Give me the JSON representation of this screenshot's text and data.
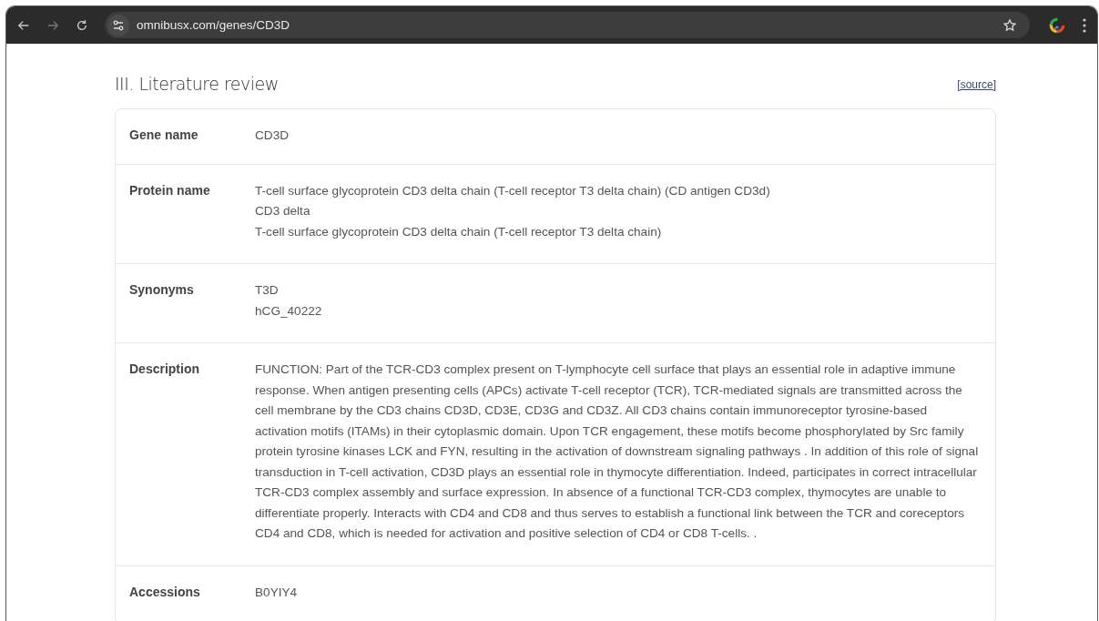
{
  "browser": {
    "url": "omnibusx.com/genes/CD3D"
  },
  "section": {
    "title": "III. Literature review",
    "source_link": "[source]"
  },
  "rows": [
    {
      "label": "Gene name",
      "values": [
        "CD3D"
      ]
    },
    {
      "label": "Protein name",
      "values": [
        "T-cell surface glycoprotein CD3 delta chain (T-cell receptor T3 delta chain) (CD antigen CD3d)",
        "CD3 delta",
        "T-cell surface glycoprotein CD3 delta chain (T-cell receptor T3 delta chain)"
      ]
    },
    {
      "label": "Synonyms",
      "values": [
        "T3D",
        "hCG_40222"
      ]
    },
    {
      "label": "Description",
      "values": [
        "FUNCTION: Part of the TCR-CD3 complex present on T-lymphocyte cell surface that plays an essential role in adaptive immune response. When antigen presenting cells (APCs) activate T-cell receptor (TCR), TCR-mediated signals are transmitted across the cell membrane by the CD3 chains CD3D, CD3E, CD3G and CD3Z. All CD3 chains contain immunoreceptor tyrosine-based activation motifs (ITAMs) in their cytoplasmic domain. Upon TCR engagement, these motifs become phosphorylated by Src family protein tyrosine kinases LCK and FYN, resulting in the activation of downstream signaling pathways . In addition of this role of signal transduction in T-cell activation, CD3D plays an essential role in thymocyte differentiation. Indeed, participates in correct intracellular TCR-CD3 complex assembly and surface expression. In absence of a functional TCR-CD3 complex, thymocytes are unable to differentiate properly. Interacts with CD4 and CD8 and thus serves to establish a functional link between the TCR and coreceptors CD4 and CD8, which is needed for activation and positive selection of CD4 or CD8 T-cells. ."
      ]
    },
    {
      "label": "Accessions",
      "values": [
        "B0YIY4"
      ]
    }
  ]
}
